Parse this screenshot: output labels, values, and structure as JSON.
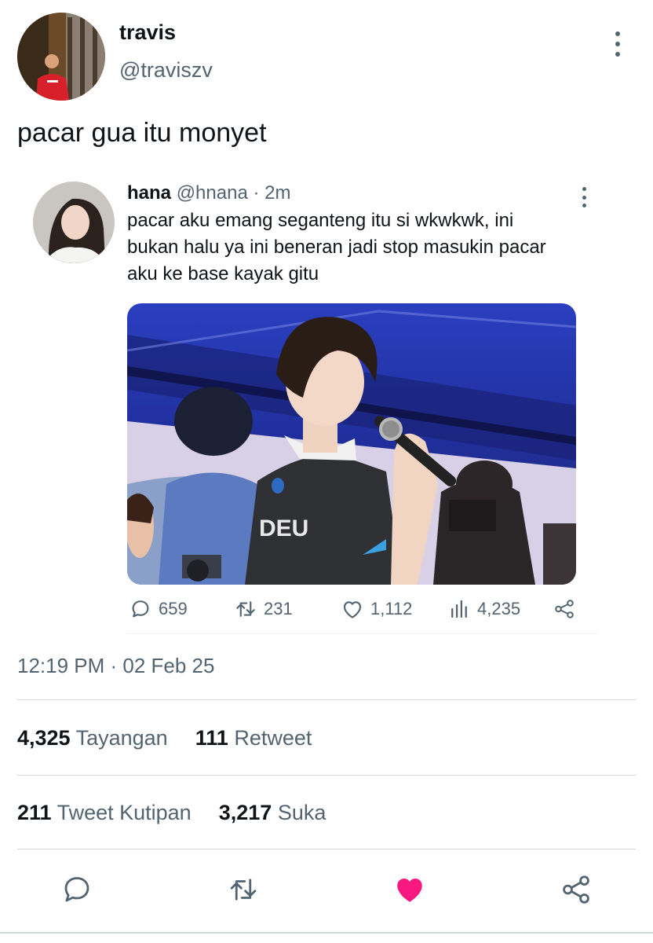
{
  "author": {
    "display_name": "travis",
    "handle": "@traviszv"
  },
  "tweet": {
    "text": "pacar gua itu monyet",
    "timestamp": "12:19 PM · 02 Feb 25"
  },
  "quoted": {
    "display_name": "hana",
    "handle_time": "@hnana · 2m",
    "text_lines": [
      "pacar aku emang seganteng itu si wkwkwk, ini",
      "bukan halu ya ini beneran jadi stop masukin pacar",
      "aku ke base kayak gitu"
    ],
    "image_jersey_text": "DEU",
    "actions": {
      "replies": "659",
      "retweets": "231",
      "likes": "1,112",
      "views": "4,235"
    }
  },
  "stats": {
    "views_count": "4,325",
    "views_label": "Tayangan",
    "retweets_count": "111",
    "retweets_label": "Retweet",
    "quotes_count": "211",
    "quotes_label": "Tweet Kutipan",
    "likes_count": "3,217",
    "likes_label": "Suka"
  },
  "colors": {
    "text": "#0f1419",
    "secondary": "#536471",
    "like_active": "#f91880",
    "divider": "#d4d9dc"
  },
  "icons": [
    "more-vertical-icon",
    "reply-icon",
    "retweet-icon",
    "heart-icon",
    "views-icon",
    "share-icon"
  ]
}
